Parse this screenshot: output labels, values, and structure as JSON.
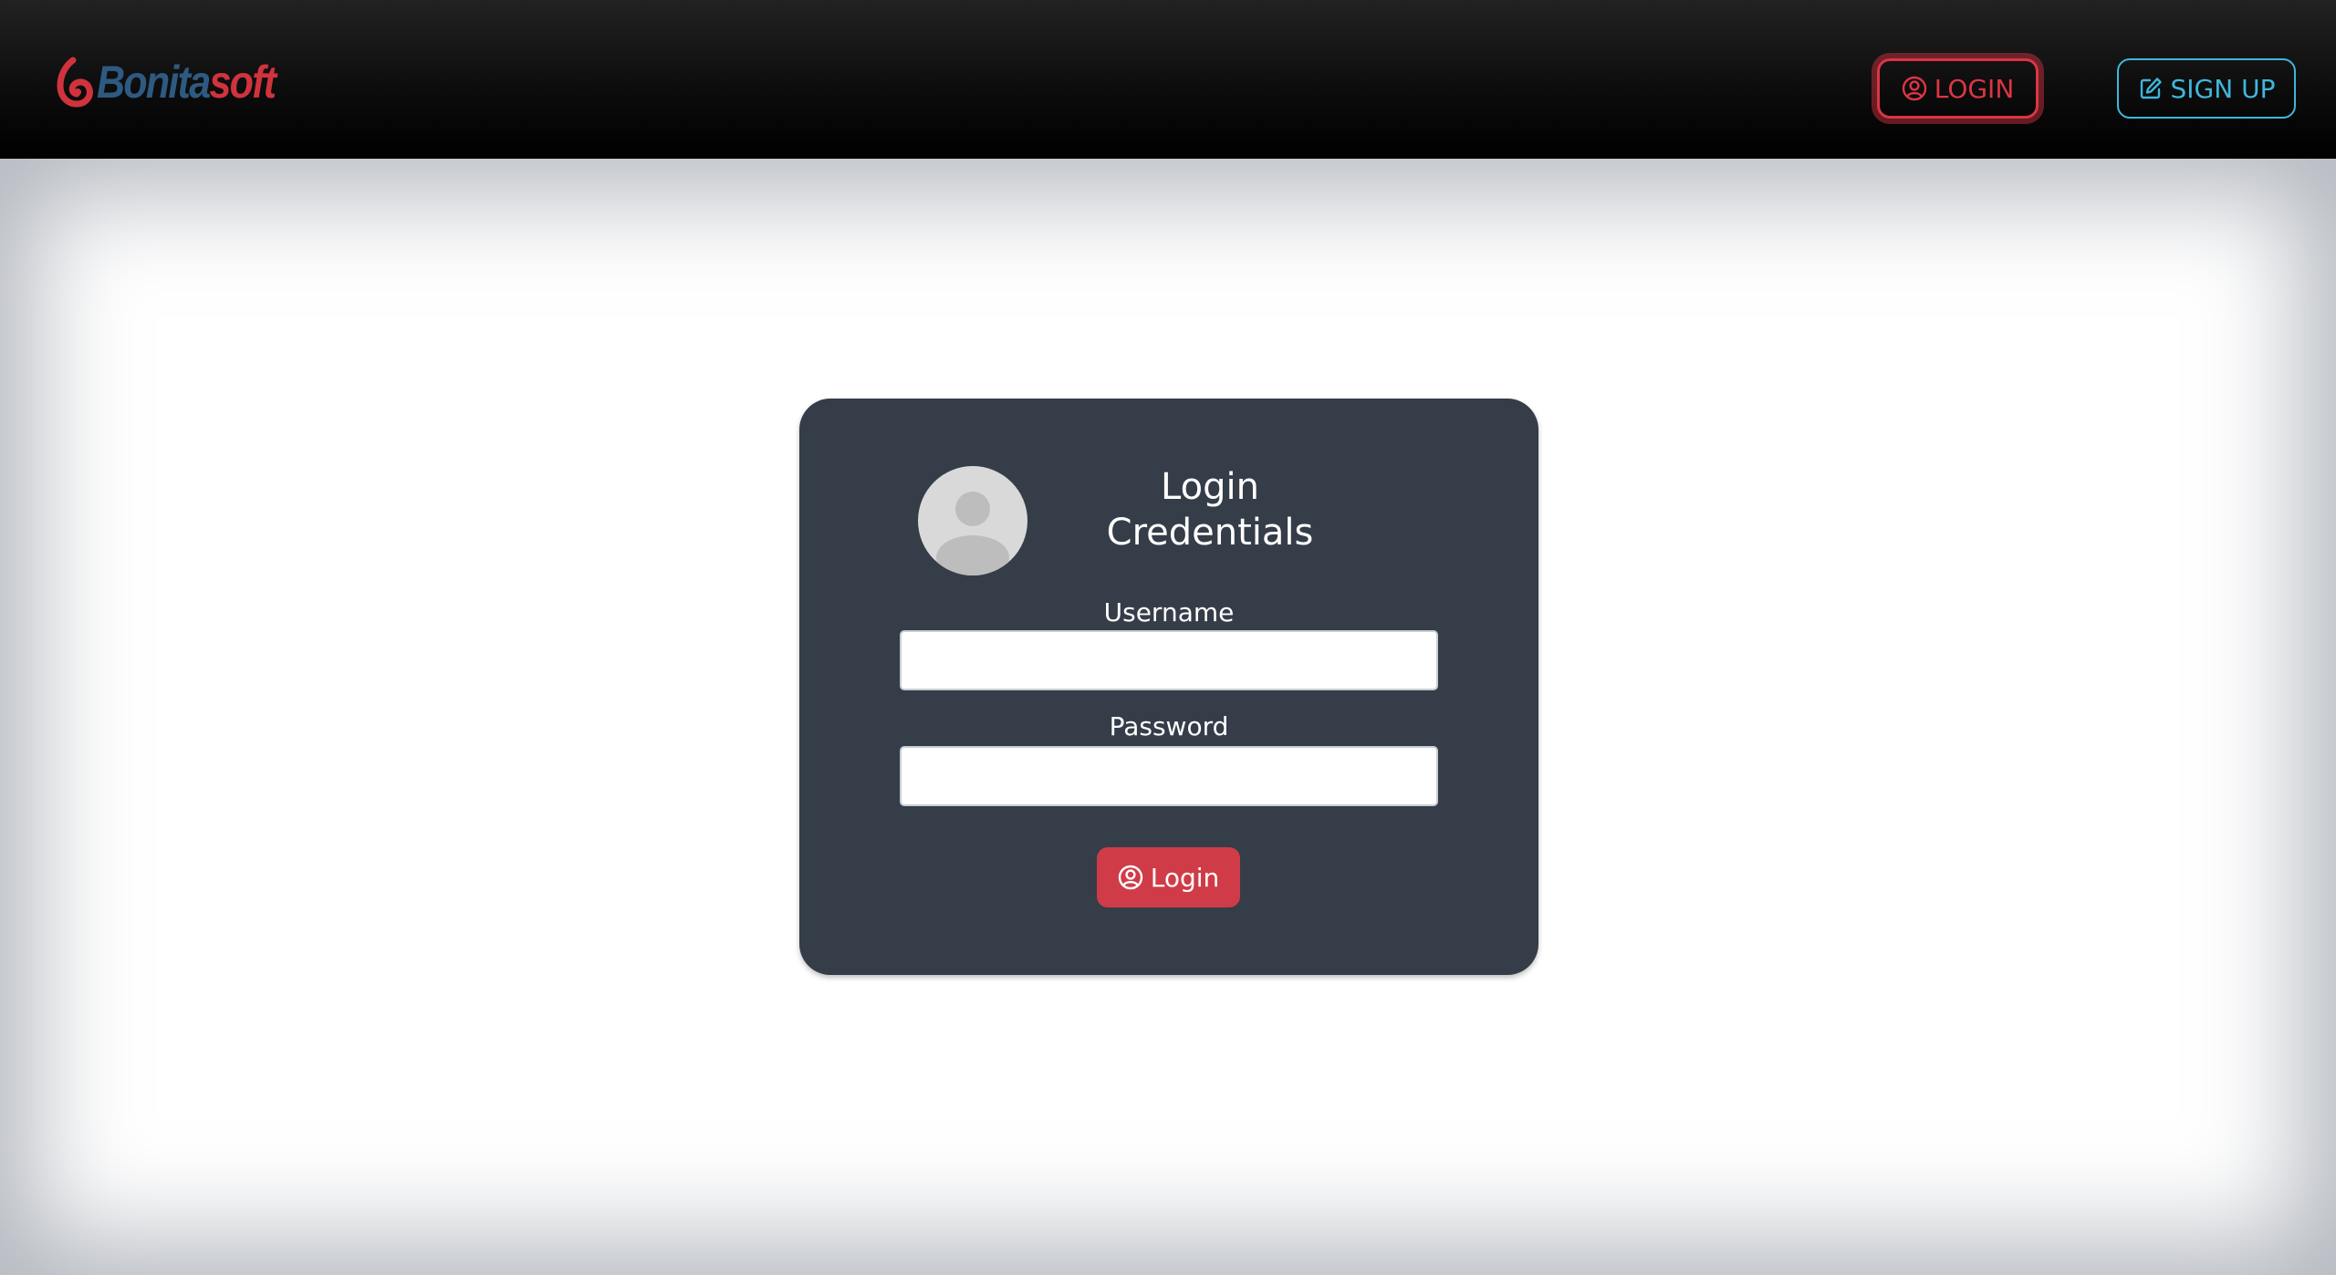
{
  "brand": {
    "name_part1": "Bonita",
    "name_part2": "soft",
    "color_dark": "#2e5a82",
    "color_accent": "#d0333d"
  },
  "nav": {
    "login_label": "LOGIN",
    "login_icon": "user-circle-icon",
    "signup_label": "SIGN UP",
    "signup_icon": "edit-square-icon",
    "login_color": "#dc3545",
    "signup_color": "#3fb6dc"
  },
  "login_card": {
    "title_line1": "Login",
    "title_line2": "Credentials",
    "avatar_icon": "default-avatar-icon",
    "username_label": "Username",
    "username_value": "",
    "password_label": "Password",
    "password_value": "",
    "submit_label": "Login",
    "submit_icon": "user-circle-icon",
    "background": "#343d48",
    "button_color": "#cf3c48"
  }
}
